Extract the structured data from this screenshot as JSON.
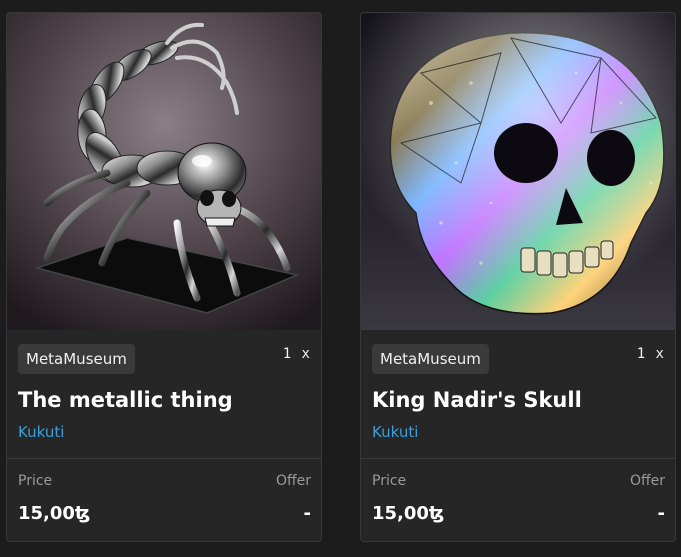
{
  "colors": {
    "page_background": "#1c1c1c",
    "card_background": "#262626",
    "badge_background": "#3a3a3a",
    "artist_link": "#3a9fd8",
    "muted_text": "#9a9a9a"
  },
  "cards": [
    {
      "image_icon": "metallic-scorpion-skull-artwork",
      "gallery": "MetaMuseum",
      "quantity": "1 x",
      "title": "The metallic thing",
      "artist": "Kukuti",
      "price_label": "Price",
      "offer_label": "Offer",
      "price": "15,00ꜩ",
      "offer": "-"
    },
    {
      "image_icon": "iridescent-crystal-skull-artwork",
      "gallery": "MetaMuseum",
      "quantity": "1 x",
      "title": "King Nadir's Skull",
      "artist": "Kukuti",
      "price_label": "Price",
      "offer_label": "Offer",
      "price": "15,00ꜩ",
      "offer": "-"
    }
  ]
}
